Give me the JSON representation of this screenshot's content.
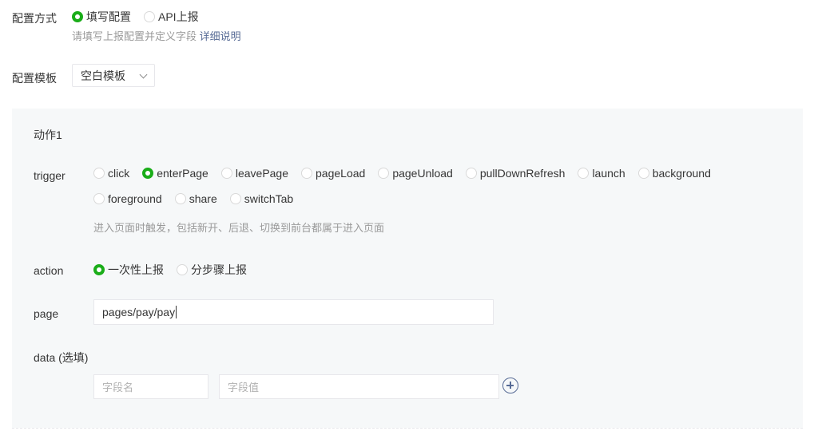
{
  "config_method": {
    "label": "配置方式",
    "options": [
      {
        "label": "填写配置",
        "checked": true
      },
      {
        "label": "API上报",
        "checked": false
      }
    ],
    "hint": "请填写上报配置并定义字段",
    "hint_link": "详细说明"
  },
  "config_template": {
    "label": "配置模板",
    "selected": "空白模板"
  },
  "action_block": {
    "title": "动作1",
    "trigger": {
      "label": "trigger",
      "options": [
        {
          "label": "click",
          "checked": false
        },
        {
          "label": "enterPage",
          "checked": true
        },
        {
          "label": "leavePage",
          "checked": false
        },
        {
          "label": "pageLoad",
          "checked": false
        },
        {
          "label": "pageUnload",
          "checked": false
        },
        {
          "label": "pullDownRefresh",
          "checked": false
        },
        {
          "label": "launch",
          "checked": false
        },
        {
          "label": "background",
          "checked": false
        },
        {
          "label": "foreground",
          "checked": false
        },
        {
          "label": "share",
          "checked": false
        },
        {
          "label": "switchTab",
          "checked": false
        }
      ],
      "hint": "进入页面时触发，包括新开、后退、切换到前台都属于进入页面"
    },
    "action": {
      "label": "action",
      "options": [
        {
          "label": "一次性上报",
          "checked": true
        },
        {
          "label": "分步骤上报",
          "checked": false
        }
      ]
    },
    "page": {
      "label": "page",
      "value": "pages/pay/pay"
    },
    "data": {
      "label": "data (选填)",
      "field_name_placeholder": "字段名",
      "field_value_placeholder": "字段值"
    }
  },
  "colors": {
    "accent_green": "#1aad19",
    "link_blue": "#576b95",
    "panel_bg": "#f6f8f9"
  },
  "icons": [
    "radio-icon",
    "chevron-down-icon",
    "add-circle-icon"
  ]
}
